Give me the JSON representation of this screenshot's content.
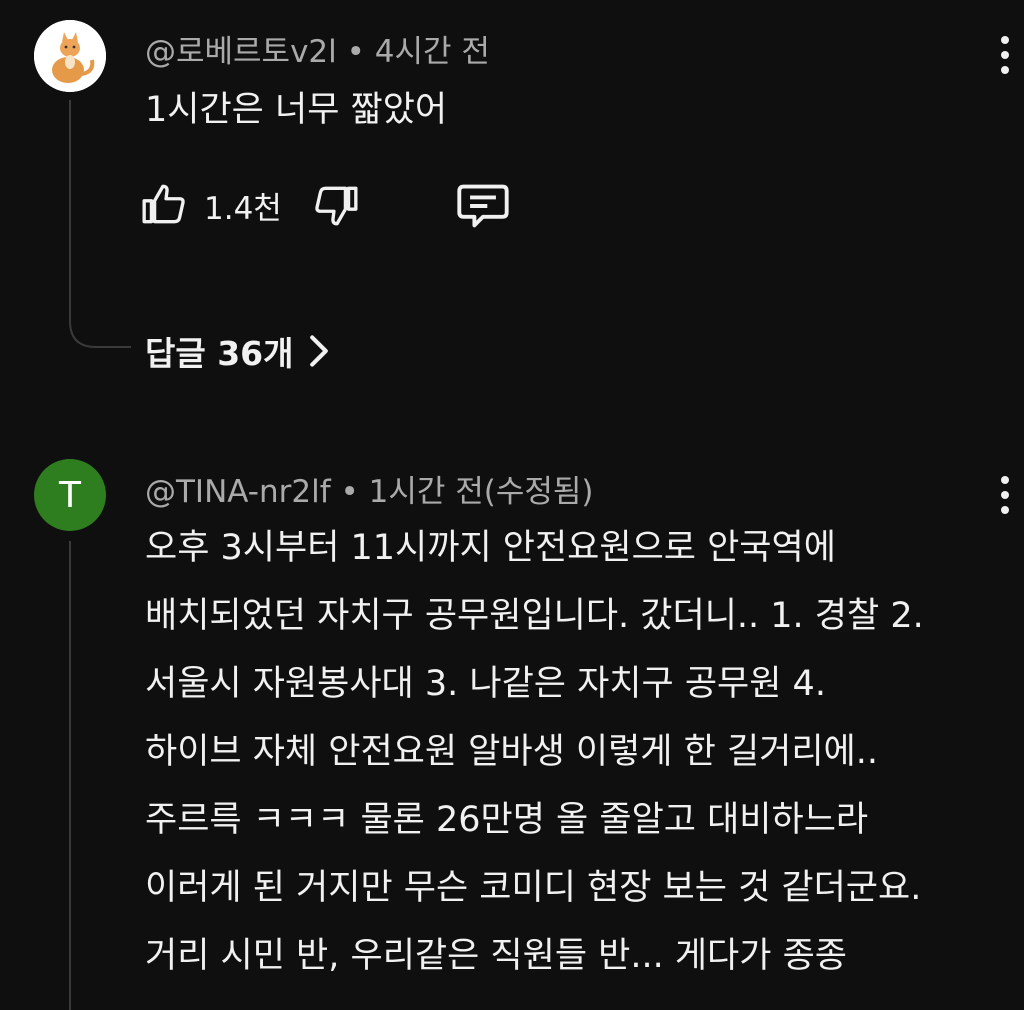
{
  "comments": [
    {
      "author": "@로베르토v2l",
      "time": "4시간 전",
      "meta": "@로베르토v2l • 4시간 전",
      "text": "1시간은 너무 짧았어",
      "likes": "1.4천",
      "replies_label": "답글 36개",
      "avatar": "cat-photo"
    },
    {
      "author": "@TINA-nr2lf",
      "time": "1시간 전(수정됨)",
      "meta": "@TINA-nr2lf • 1시간 전(수정됨)",
      "avatar_letter": "T",
      "text_lines": [
        "오후 3시부터 11시까지 안전요원으로 안국역에",
        "배치되었던 자치구 공무원입니다. 갔더니.. 1. 경찰 2.",
        "서울시 자원봉사대 3. 나같은 자치구 공무원 4.",
        "하이브 자체 안전요원 알바생 이렇게 한 길거리에..",
        "주르륵 ㅋㅋㅋ 물론 26만명 올 줄알고 대비하느라",
        "이러게 된 거지만 무슨 코미디 현장 보는 것 같더군요.",
        "거리 시민 반, 우리같은 직원들 반... 게다가 종종"
      ]
    }
  ],
  "icons": {
    "like": "thumbs-up-icon",
    "dislike": "thumbs-down-icon",
    "reply": "comment-icon",
    "more": "more-vert-icon",
    "chevron": "chevron-right-icon"
  },
  "colors": {
    "background": "#0f0f0f",
    "text": "#f1f1f1",
    "meta": "#aaaaaa",
    "avatar_t": "#2e7d1f"
  }
}
